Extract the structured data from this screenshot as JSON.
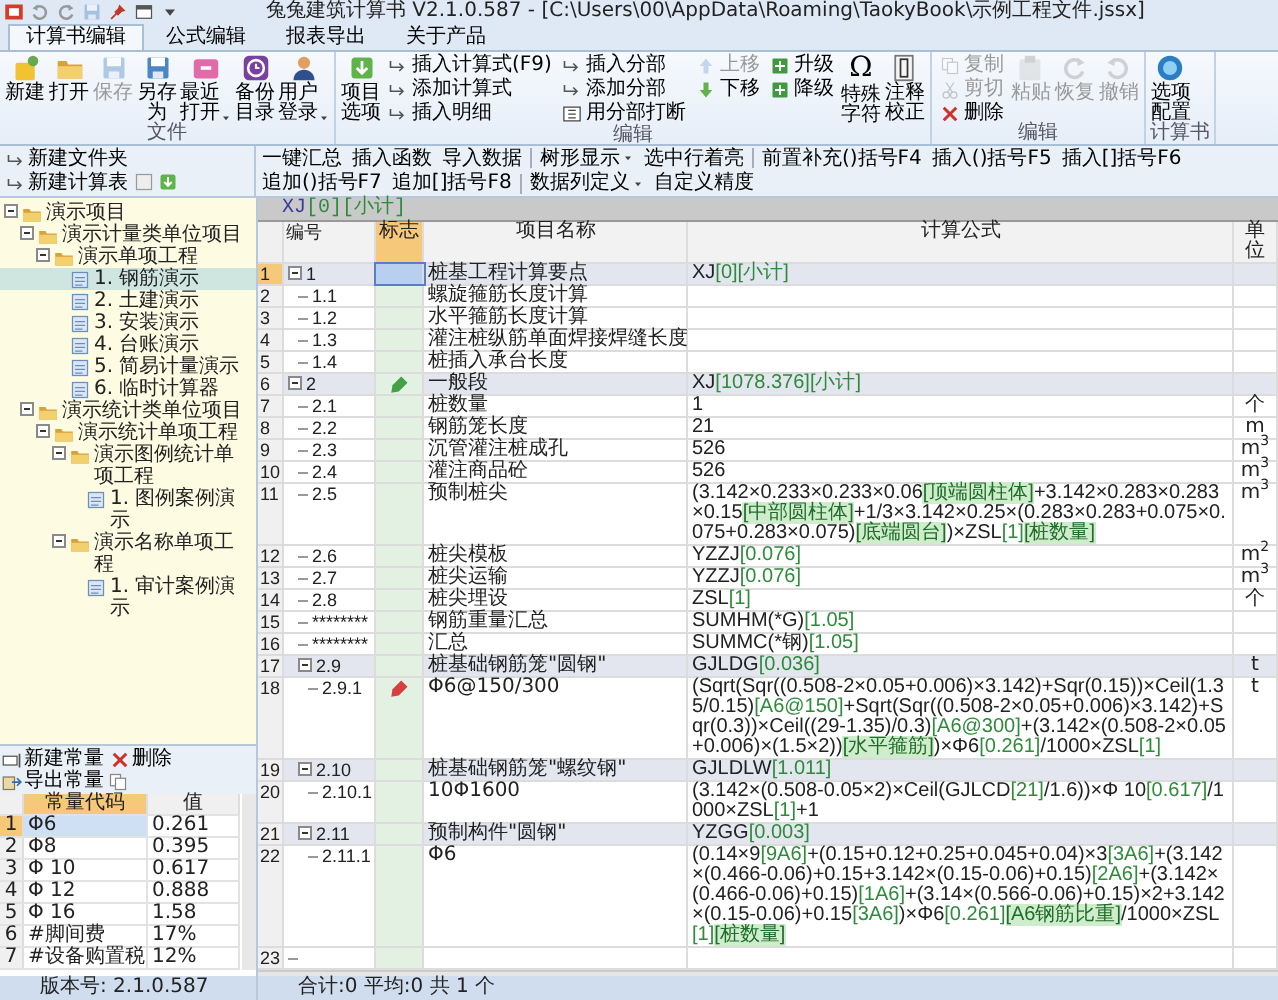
{
  "window": {
    "title": "兔兔建筑计算书 V2.1.0.587 - [C:\\Users\\00\\AppData\\Roaming\\TaokyBook\\示例工程文件.jssx]"
  },
  "tabs": [
    {
      "label": "计算书编辑",
      "selected": true
    },
    {
      "label": "公式编辑",
      "selected": false
    },
    {
      "label": "报表导出",
      "selected": false
    },
    {
      "label": "关于产品",
      "selected": false
    }
  ],
  "ribbon": [
    {
      "label": "文件",
      "items": [
        {
          "kind": "large",
          "label": "新建",
          "disabled": false,
          "dropdown": false
        },
        {
          "kind": "large",
          "label": "打开",
          "disabled": false,
          "dropdown": false
        },
        {
          "kind": "large",
          "label": "保存",
          "disabled": true,
          "dropdown": false
        },
        {
          "kind": "large",
          "label": "另存为",
          "disabled": false,
          "dropdown": false
        },
        {
          "kind": "large",
          "label": "最近打开",
          "disabled": false,
          "dropdown": true
        },
        {
          "kind": "large",
          "label": "备份目录",
          "disabled": false,
          "dropdown": false
        },
        {
          "kind": "large",
          "label": "用户登录",
          "disabled": false,
          "dropdown": true
        }
      ]
    },
    {
      "label": "编辑",
      "items": [
        {
          "kind": "large",
          "label": "项目选项",
          "disabled": false,
          "dropdown": false
        },
        {
          "kind": "column",
          "buttons": [
            {
              "label": "插入计算式(F9)",
              "disabled": false
            },
            {
              "label": "添加计算式",
              "disabled": false
            },
            {
              "label": "插入明细",
              "disabled": false
            }
          ]
        },
        {
          "kind": "column",
          "buttons": [
            {
              "label": "插入分部",
              "disabled": false
            },
            {
              "label": "添加分部",
              "disabled": false
            },
            {
              "label": "用分部打断",
              "disabled": false
            }
          ]
        },
        {
          "kind": "column",
          "buttons": [
            {
              "label": "上移",
              "disabled": true
            },
            {
              "label": "下移",
              "disabled": false
            }
          ]
        },
        {
          "kind": "column",
          "buttons": [
            {
              "label": "升级",
              "disabled": false
            },
            {
              "label": "降级",
              "disabled": false
            }
          ]
        },
        {
          "kind": "large",
          "label": "特殊字符",
          "icon_text": "Ω",
          "disabled": false,
          "dropdown": false
        },
        {
          "kind": "large",
          "label": "注释校正",
          "disabled": false,
          "dropdown": false
        }
      ]
    },
    {
      "label": "编辑",
      "items": [
        {
          "kind": "column",
          "buttons": [
            {
              "label": "复制",
              "disabled": true
            },
            {
              "label": "剪切",
              "disabled": true
            },
            {
              "label": "删除",
              "disabled": false
            }
          ]
        },
        {
          "kind": "large",
          "label": "粘贴",
          "disabled": true,
          "dropdown": false
        },
        {
          "kind": "large",
          "label": "恢复",
          "disabled": true,
          "dropdown": false
        },
        {
          "kind": "large",
          "label": "撤销",
          "disabled": true,
          "dropdown": false
        }
      ]
    },
    {
      "label": "计算书",
      "items": [
        {
          "kind": "large",
          "label": "选项配置",
          "disabled": false,
          "dropdown": false
        }
      ]
    }
  ],
  "left_toolbar": [
    {
      "label": "新建文件夹"
    },
    {
      "label": "新建计算表"
    }
  ],
  "toolbar": [
    [
      {
        "label": "一键汇总",
        "dropdown": false
      },
      {
        "label": "插入函数",
        "dropdown": false
      },
      {
        "label": "导入数据",
        "dropdown": false
      }
    ],
    [
      {
        "label": "树形显示",
        "dropdown": true
      },
      {
        "label": "选中行着亮",
        "dropdown": false
      }
    ],
    [
      {
        "label": "前置补充()括号F4",
        "dropdown": false
      },
      {
        "label": "插入()括号F5",
        "dropdown": false
      },
      {
        "label": "插入[]括号F6",
        "dropdown": false
      },
      {
        "label": "追加()括号F7",
        "dropdown": false
      },
      {
        "label": "追加[]括号F8",
        "dropdown": false
      }
    ],
    [
      {
        "label": "数据列定义",
        "dropdown": true
      },
      {
        "label": "自定义精度",
        "dropdown": false
      }
    ]
  ],
  "tree": [
    {
      "label": "演示项目",
      "kind": "folder",
      "expanded": true,
      "selected": false,
      "children": [
        {
          "label": "演示计量类单位项目",
          "kind": "folder",
          "expanded": true,
          "selected": false,
          "children": [
            {
              "label": "演示单项工程",
              "kind": "folder",
              "expanded": true,
              "selected": false,
              "children": [
                {
                  "label": "1. 钢筋演示",
                  "kind": "file",
                  "selected": true
                },
                {
                  "label": "2. 土建演示",
                  "kind": "file",
                  "selected": false
                },
                {
                  "label": "3. 安装演示",
                  "kind": "file",
                  "selected": false
                },
                {
                  "label": "4. 台账演示",
                  "kind": "file",
                  "selected": false
                },
                {
                  "label": "5. 简易计量演示",
                  "kind": "file",
                  "selected": false
                },
                {
                  "label": "6. 临时计算器",
                  "kind": "file",
                  "selected": false
                }
              ]
            }
          ]
        },
        {
          "label": "演示统计类单位项目",
          "kind": "folder",
          "expanded": true,
          "selected": false,
          "children": [
            {
              "label": "演示统计单项工程",
              "kind": "folder",
              "expanded": true,
              "selected": false,
              "children": [
                {
                  "label": "演示图例统计单项工程",
                  "kind": "folder",
                  "expanded": true,
                  "selected": false,
                  "children": [
                    {
                      "label": "1. 图例案例演示",
                      "kind": "file",
                      "selected": false
                    }
                  ]
                },
                {
                  "label": "演示名称单项工程",
                  "kind": "folder",
                  "expanded": true,
                  "selected": false,
                  "children": [
                    {
                      "label": "1. 审计案例演示",
                      "kind": "file",
                      "selected": false
                    }
                  ]
                }
              ]
            }
          ]
        }
      ]
    }
  ],
  "constants": {
    "toolbar": [
      {
        "label": "新建常量"
      },
      {
        "label": "删除"
      },
      {
        "label": "导出常量"
      }
    ],
    "columns": [
      {
        "label": "常量代码",
        "selected": true
      },
      {
        "label": "值",
        "selected": false
      }
    ],
    "rows": [
      {
        "num": "1",
        "code": "Φ6",
        "value": "0.261",
        "selected": true
      },
      {
        "num": "2",
        "code": "Φ8",
        "value": "0.395",
        "selected": false
      },
      {
        "num": "3",
        "code": "Φ 10",
        "value": "0.617",
        "selected": false
      },
      {
        "num": "4",
        "code": "Φ 12",
        "value": "0.888",
        "selected": false
      },
      {
        "num": "5",
        "code": "Φ 16",
        "value": "1.58",
        "selected": false
      },
      {
        "num": "6",
        "code": "#脚间费",
        "value": "17%",
        "selected": false
      },
      {
        "num": "7",
        "code": "#设备购置税",
        "value": "12%",
        "selected": false
      }
    ]
  },
  "version": "版本号: 2.1.0.587",
  "formula_bar": [
    {
      "text": "XJ",
      "kind": "plain"
    },
    {
      "text": "[0][小计]",
      "kind": "value"
    }
  ],
  "table": {
    "columns": [
      {
        "label": "编号",
        "selected": false
      },
      {
        "label": "标志",
        "selected": true
      },
      {
        "label": "项目名称",
        "selected": false
      },
      {
        "label": "计算公式",
        "selected": false
      },
      {
        "label": "单位",
        "selected": false
      }
    ],
    "rows": [
      {
        "num": "1",
        "code": "1",
        "kind": "group",
        "expanded": true,
        "selected": true,
        "name": "桩基工程计算要点",
        "formula": [
          {
            "text": "XJ",
            "kind": "plain"
          },
          {
            "text": "[0][小计]",
            "kind": "value"
          }
        ],
        "children": [
          {
            "num": "2",
            "code": "1.1",
            "kind": "item",
            "selected": false,
            "name": "螺旋箍筋长度计算"
          },
          {
            "num": "3",
            "code": "1.2",
            "kind": "item",
            "selected": false,
            "name": "水平箍筋长度计算"
          },
          {
            "num": "4",
            "code": "1.3",
            "kind": "item",
            "selected": false,
            "name": "灌注桩纵筋单面焊接焊缝长度"
          },
          {
            "num": "5",
            "code": "1.4",
            "kind": "item",
            "selected": false,
            "name": "桩插入承台长度"
          }
        ]
      },
      {
        "num": "6",
        "code": "2",
        "kind": "group",
        "expanded": true,
        "selected": false,
        "flag": {
          "color": "#43a047"
        },
        "name": "一般段",
        "formula": [
          {
            "text": "XJ",
            "kind": "plain"
          },
          {
            "text": "[1078.376][小计]",
            "kind": "value"
          }
        ],
        "children": [
          {
            "num": "7",
            "code": "2.1",
            "kind": "item",
            "selected": false,
            "name": "桩数量",
            "unit": "个",
            "formula": [
              {
                "text": "1",
                "kind": "plain"
              }
            ]
          },
          {
            "num": "8",
            "code": "2.2",
            "kind": "item",
            "selected": false,
            "name": "钢筋笼长度",
            "unit": "m",
            "formula": [
              {
                "text": "21",
                "kind": "plain"
              }
            ]
          },
          {
            "num": "9",
            "code": "2.3",
            "kind": "item",
            "selected": false,
            "name": "沉管灌注桩成孔",
            "unit": "m$^{3}$",
            "formula": [
              {
                "text": "526",
                "kind": "plain"
              }
            ]
          },
          {
            "num": "10",
            "code": "2.4",
            "kind": "item",
            "selected": false,
            "name": "灌注商品砼",
            "unit": "m$^{3}$",
            "formula": [
              {
                "text": "526",
                "kind": "plain"
              }
            ]
          },
          {
            "num": "11",
            "code": "2.5",
            "kind": "item",
            "selected": false,
            "name": "预制桩尖",
            "unit": "m$^{3}$",
            "formula": [
              {
                "text": "(3.142×0.233×0.233×0.06",
                "kind": "plain"
              },
              {
                "text": "[顶端圆柱体]",
                "kind": "label"
              },
              {
                "text": "+3.142×0.283×0.283×0.15",
                "kind": "plain"
              },
              {
                "text": "[中部圆柱体]",
                "kind": "label"
              },
              {
                "text": "+1/3×3.142×0.25×(0.283×0.283+0.075×0.075+0.283×0.075)",
                "kind": "plain"
              },
              {
                "text": "[底端圆台]",
                "kind": "label"
              },
              {
                "text": ")×ZSL",
                "kind": "plain"
              },
              {
                "text": "[1]",
                "kind": "value"
              },
              {
                "text": "[桩数量]",
                "kind": "label"
              }
            ]
          },
          {
            "num": "12",
            "code": "2.6",
            "kind": "item",
            "selected": false,
            "name": "桩尖模板",
            "unit": "m$^{2}$",
            "formula": [
              {
                "text": "YZZJ",
                "kind": "plain"
              },
              {
                "text": "[0.076]",
                "kind": "value"
              }
            ]
          },
          {
            "num": "13",
            "code": "2.7",
            "kind": "item",
            "selected": false,
            "name": "桩尖运输",
            "unit": "m$^{3}$",
            "formula": [
              {
                "text": "YZZJ",
                "kind": "plain"
              },
              {
                "text": "[0.076]",
                "kind": "value"
              }
            ]
          },
          {
            "num": "14",
            "code": "2.8",
            "kind": "item",
            "selected": false,
            "name": "桩尖埋设",
            "unit": "个",
            "formula": [
              {
                "text": "ZSL",
                "kind": "plain"
              },
              {
                "text": "[1]",
                "kind": "value"
              }
            ]
          },
          {
            "num": "15",
            "code": "********",
            "kind": "item",
            "selected": false,
            "name": "钢筋重量汇总",
            "formula": [
              {
                "text": "SUMHM(*G)",
                "kind": "plain"
              },
              {
                "text": "[1.05]",
                "kind": "value"
              }
            ]
          },
          {
            "num": "16",
            "code": "********",
            "kind": "item",
            "selected": false,
            "name": "汇总",
            "formula": [
              {
                "text": "SUMMC(*钢)",
                "kind": "plain"
              },
              {
                "text": "[1.05]",
                "kind": "value"
              }
            ]
          },
          {
            "num": "17",
            "code": "2.9",
            "kind": "group",
            "expanded": true,
            "selected": false,
            "name": "桩基础钢筋笼\"圆钢\"",
            "unit": "t",
            "formula": [
              {
                "text": "GJLDG",
                "kind": "plain"
              },
              {
                "text": "[0.036]",
                "kind": "value"
              }
            ],
            "children": [
              {
                "num": "18",
                "code": "2.9.1",
                "kind": "item",
                "selected": false,
                "flag": {
                  "color": "#d84040"
                },
                "name": "Φ6@150/300",
                "unit": "t",
                "formula": [
                  {
                    "text": "(Sqrt(Sqr((0.508-2×0.05+0.006)×3.142)+Sqr(0.15))×Ceil(1.35/0.15)",
                    "kind": "plain"
                  },
                  {
                    "text": "[A6@150]",
                    "kind": "value"
                  },
                  {
                    "text": "+Sqrt(Sqr((0.508-2×0.05+0.006)×3.142)+Sqr(0.3))×Ceil((29-1.35)/0.3)",
                    "kind": "plain"
                  },
                  {
                    "text": "[A6@300]",
                    "kind": "value"
                  },
                  {
                    "text": "+(3.142×(0.508-2×0.05+0.006)×(1.5×2))",
                    "kind": "plain"
                  },
                  {
                    "text": "[水平箍筋]",
                    "kind": "label"
                  },
                  {
                    "text": ")×Φ6",
                    "kind": "plain"
                  },
                  {
                    "text": "[0.261]",
                    "kind": "value"
                  },
                  {
                    "text": "/1000×ZSL",
                    "kind": "plain"
                  },
                  {
                    "text": "[1]",
                    "kind": "value"
                  }
                ]
              }
            ]
          },
          {
            "num": "19",
            "code": "2.10",
            "kind": "group",
            "expanded": true,
            "selected": false,
            "name": "桩基础钢筋笼\"螺纹钢\"",
            "formula": [
              {
                "text": "GJLDLW",
                "kind": "plain"
              },
              {
                "text": "[1.011]",
                "kind": "value"
              }
            ],
            "children": [
              {
                "num": "20",
                "code": "2.10.1",
                "kind": "item",
                "selected": false,
                "name": "10Φ1600",
                "formula": [
                  {
                    "text": "(3.142×(0.508-0.05×2)×Ceil(GJLCD",
                    "kind": "plain"
                  },
                  {
                    "text": "[21]",
                    "kind": "value"
                  },
                  {
                    "text": "/1.6))×Φ 10",
                    "kind": "plain"
                  },
                  {
                    "text": "[0.617]",
                    "kind": "value"
                  },
                  {
                    "text": "/1000×ZSL",
                    "kind": "plain"
                  },
                  {
                    "text": "[1]",
                    "kind": "value"
                  },
                  {
                    "text": "+1",
                    "kind": "plain"
                  }
                ]
              }
            ]
          },
          {
            "num": "21",
            "code": "2.11",
            "kind": "group",
            "expanded": true,
            "selected": false,
            "name": "预制构件\"圆钢\"",
            "formula": [
              {
                "text": "YZGG",
                "kind": "plain"
              },
              {
                "text": "[0.003]",
                "kind": "value"
              }
            ],
            "children": [
              {
                "num": "22",
                "code": "2.11.1",
                "kind": "item",
                "selected": false,
                "name": "Φ6",
                "formula": [
                  {
                    "text": "(0.14×9",
                    "kind": "plain"
                  },
                  {
                    "text": "[9A6]",
                    "kind": "value"
                  },
                  {
                    "text": "+(0.15+0.12+0.25+0.045+0.04)×3",
                    "kind": "plain"
                  },
                  {
                    "text": "[3A6]",
                    "kind": "value"
                  },
                  {
                    "text": "+(3.142×(0.466-0.06)+0.15+3.142×(0.15-0.06)+0.15)",
                    "kind": "plain"
                  },
                  {
                    "text": "[2A6]",
                    "kind": "value"
                  },
                  {
                    "text": "+(3.142×(0.466-0.06)+0.15)",
                    "kind": "plain"
                  },
                  {
                    "text": "[1A6]",
                    "kind": "value"
                  },
                  {
                    "text": "+(3.14×(0.566-0.06)+0.15)×2+3.142×(0.15-0.06)+0.15",
                    "kind": "plain"
                  },
                  {
                    "text": "[3A6]",
                    "kind": "value"
                  },
                  {
                    "text": ")×Φ6",
                    "kind": "plain"
                  },
                  {
                    "text": "[0.261]",
                    "kind": "value"
                  },
                  {
                    "text": "[A6钢筋比重]",
                    "kind": "label"
                  },
                  {
                    "text": "/1000×ZSL",
                    "kind": "plain"
                  },
                  {
                    "text": "[1]",
                    "kind": "value"
                  },
                  {
                    "text": "[桩数量]",
                    "kind": "label"
                  }
                ]
              }
            ]
          }
        ]
      },
      {
        "num": "23",
        "kind": "item",
        "selected": false
      }
    ]
  },
  "status": "合计:0 平均:0 共 1 个"
}
